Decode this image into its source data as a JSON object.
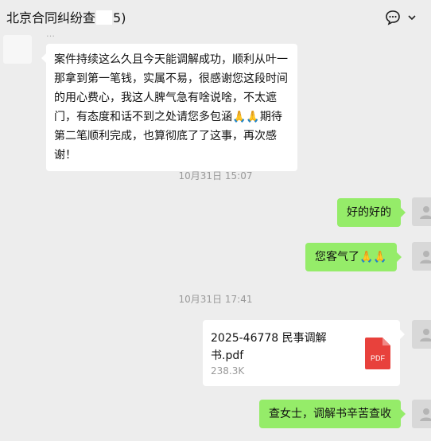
{
  "header": {
    "title_prefix": "北京合同纠纷查",
    "title_suffix": "5)",
    "icons": [
      "chat-bubble-icon",
      "chevron-down-icon"
    ]
  },
  "messages": {
    "sender_name": "…",
    "incoming_text": "案件持续这么久且今天能调解成功，顺利从叶一那拿到第一笔钱，实属不易，很感谢您这段时间的用心费心，我这人脾气急有啥说啥，不太遮门，有态度和话不到之处请您多包涵🙏🙏期待第二笔顺利完成，也算彻底了了这事，再次感谢！",
    "time1": "10月31日 15:07",
    "reply1": "好的好的",
    "reply2": "您客气了🙏🙏",
    "time2": "10月31日 17:41",
    "file_name": "2025-46778        民事调解书.pdf",
    "file_size": "238.3K",
    "file_type": "PDF",
    "reply3": "查女士，调解书辛苦查收"
  },
  "colors": {
    "background": "#ededed",
    "outgoing_bubble": "#95ec69",
    "incoming_bubble": "#ffffff",
    "pdf_red": "#e8413c"
  }
}
